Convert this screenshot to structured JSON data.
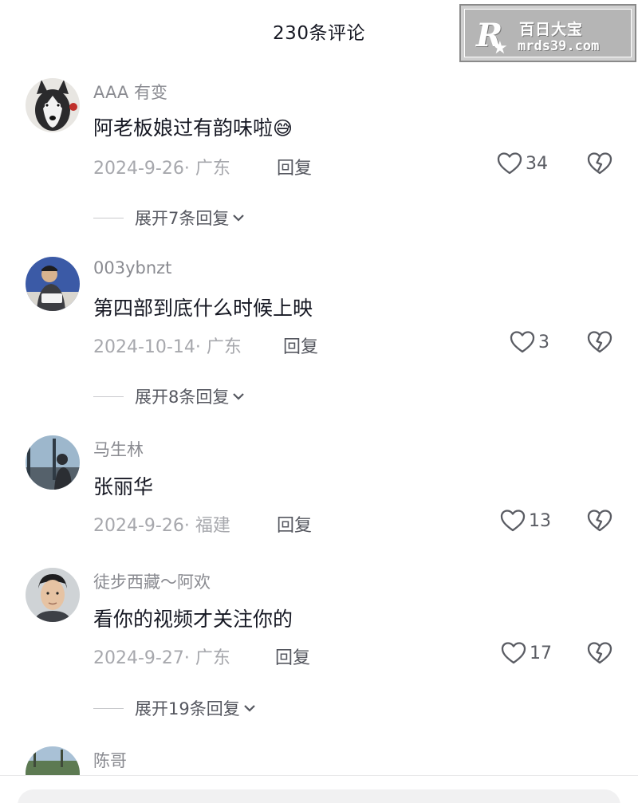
{
  "header": {
    "title": "230条评论"
  },
  "watermark": {
    "logo": "R",
    "title": "百日大宝",
    "url": "mrds39.com"
  },
  "comments": [
    {
      "username": "AAA 有变",
      "content": "阿老板娘过有韵味啦",
      "emoji": "😅",
      "date": "2024-9-26",
      "location": "· 广东",
      "reply": "回复",
      "likes": "34",
      "expand": "展开7条回复"
    },
    {
      "username": "003ybnzt",
      "content": "第四部到底什么时候上映",
      "date": "2024-10-14",
      "location": "· 广东",
      "reply": "回复",
      "likes": "3",
      "expand": "展开8条回复"
    },
    {
      "username": "马生林",
      "content": "张丽华",
      "date": "2024-9-26",
      "location": "· 福建",
      "reply": "回复",
      "likes": "13"
    },
    {
      "username": "徒步西藏～阿欢",
      "content": "看你的视频才关注你的",
      "date": "2024-9-27",
      "location": "· 广东",
      "reply": "回复",
      "likes": "17",
      "expand": "展开19条回复"
    },
    {
      "username": "陈哥"
    }
  ],
  "icons": {
    "like": "heart-outline-icon",
    "dislike": "broken-heart-icon",
    "expand": "chevron-down-icon"
  },
  "colors": {
    "text": "#161823",
    "secondary": "#a7a8ad"
  }
}
